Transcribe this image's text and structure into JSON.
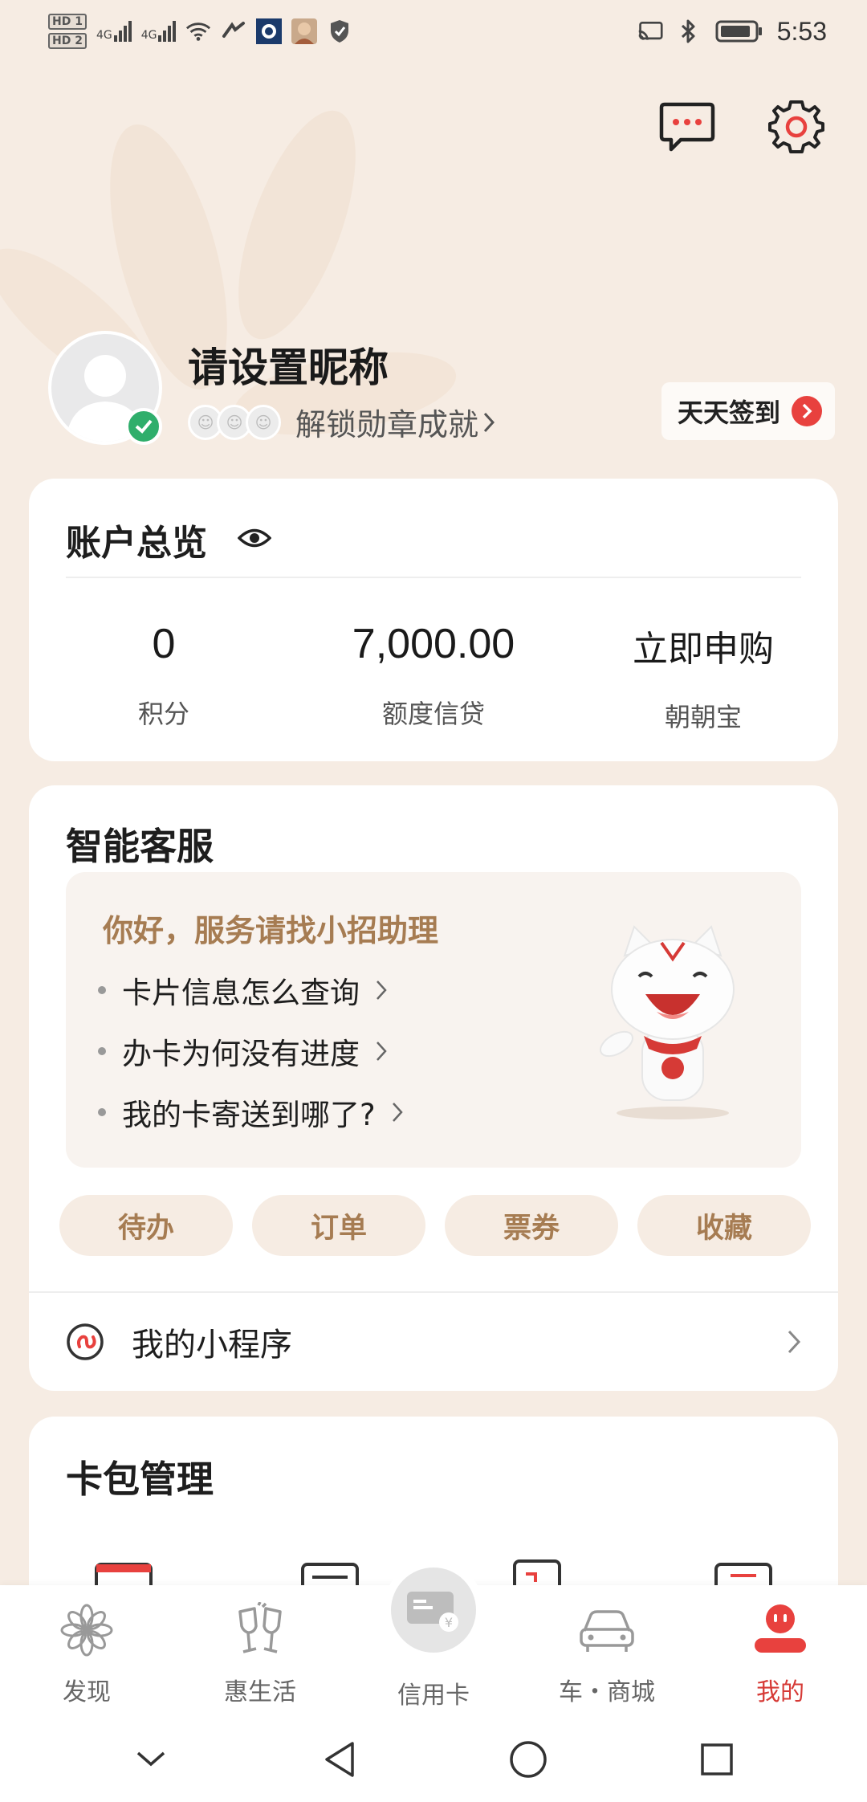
{
  "status_bar": {
    "hd1": "HD 1",
    "hd2": "HD 2",
    "net1": "4G",
    "net2": "4G",
    "time": "5:53",
    "icons": [
      "wifi-icon",
      "nfc-icon",
      "app-notification-icon",
      "avatar-notification-icon",
      "shield-icon",
      "cast-icon",
      "bluetooth-icon",
      "battery-icon"
    ]
  },
  "header": {
    "icons": [
      "message-icon",
      "settings-icon"
    ]
  },
  "profile": {
    "nickname": "请设置昵称",
    "unlock_text": "解锁勋章成就",
    "checkin_label": "天天签到"
  },
  "account": {
    "title": "账户总览",
    "stats": [
      {
        "value": "0",
        "label": "积分"
      },
      {
        "value": "7,000.00",
        "label": "额度信贷"
      },
      {
        "value": "立即申购",
        "label": "朝朝宝"
      }
    ]
  },
  "service": {
    "title": "智能客服",
    "greeting": "你好，服务请找小招助理",
    "questions": [
      "卡片信息怎么查询",
      "办卡为何没有进度",
      "我的卡寄送到哪了?"
    ],
    "pills": [
      "待办",
      "订单",
      "票券",
      "收藏"
    ],
    "mini_program": "我的小程序"
  },
  "wallet": {
    "title": "卡包管理"
  },
  "tabbar": {
    "tabs": [
      {
        "label": "发现",
        "icon": "discover-icon"
      },
      {
        "label": "惠生活",
        "icon": "cheers-icon"
      },
      {
        "label": "信用卡",
        "icon": "credit-card-icon"
      },
      {
        "label": "车・商城",
        "icon": "car-icon"
      },
      {
        "label": "我的",
        "icon": "profile-icon"
      }
    ],
    "active_color": "#d63a36"
  },
  "colors": {
    "accent_red": "#e8413e",
    "gold": "#a67c52",
    "background": "#f6ece3"
  }
}
